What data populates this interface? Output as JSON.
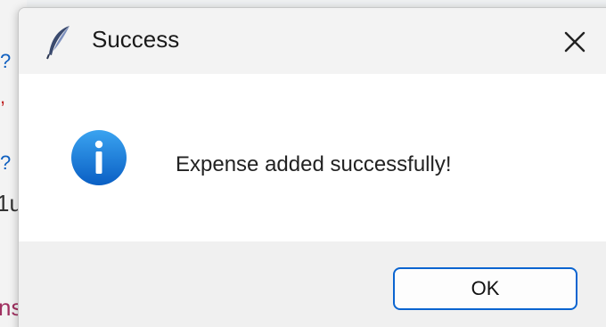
{
  "background": {
    "fragments": [
      {
        "text": "?",
        "color": "#1060c0"
      },
      {
        "text": ",",
        "color": "#c02020"
      },
      {
        "text": "?",
        "color": "#1060c0"
      },
      {
        "text": "1u",
        "color": "#333333"
      },
      {
        "text": "ns",
        "color": "#a03060"
      }
    ]
  },
  "dialog": {
    "title": "Success",
    "title_icon": "feather-icon",
    "close_icon": "close-icon",
    "message_icon": "info-icon",
    "message": "Expense added successfully!",
    "ok_label": "OK",
    "accent_color": "#0a64d0"
  }
}
